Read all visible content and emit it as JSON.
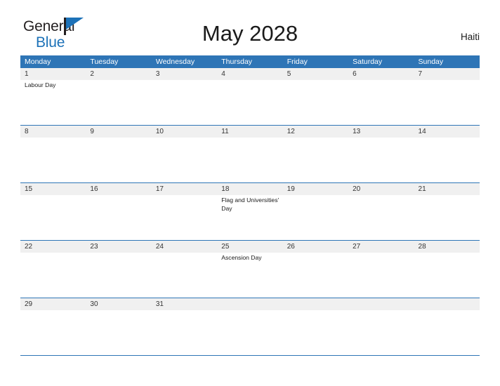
{
  "brand": {
    "line1": "General",
    "line2": "Blue",
    "flag_icon": "flag-triangle-icon",
    "color_text": "#231f20",
    "color_accent": "#1d72b8"
  },
  "header": {
    "title": "May 2028",
    "country": "Haiti"
  },
  "calendar": {
    "header_color": "#2e75b6",
    "date_band_color": "#f0f0f0",
    "weekdays": [
      "Monday",
      "Tuesday",
      "Wednesday",
      "Thursday",
      "Friday",
      "Saturday",
      "Sunday"
    ],
    "weeks": [
      {
        "days": [
          {
            "num": "1",
            "events": [
              "Labour Day"
            ]
          },
          {
            "num": "2",
            "events": []
          },
          {
            "num": "3",
            "events": []
          },
          {
            "num": "4",
            "events": []
          },
          {
            "num": "5",
            "events": []
          },
          {
            "num": "6",
            "events": []
          },
          {
            "num": "7",
            "events": []
          }
        ]
      },
      {
        "days": [
          {
            "num": "8",
            "events": []
          },
          {
            "num": "9",
            "events": []
          },
          {
            "num": "10",
            "events": []
          },
          {
            "num": "11",
            "events": []
          },
          {
            "num": "12",
            "events": []
          },
          {
            "num": "13",
            "events": []
          },
          {
            "num": "14",
            "events": []
          }
        ]
      },
      {
        "days": [
          {
            "num": "15",
            "events": []
          },
          {
            "num": "16",
            "events": []
          },
          {
            "num": "17",
            "events": []
          },
          {
            "num": "18",
            "events": [
              "Flag and Universities' Day"
            ]
          },
          {
            "num": "19",
            "events": []
          },
          {
            "num": "20",
            "events": []
          },
          {
            "num": "21",
            "events": []
          }
        ]
      },
      {
        "days": [
          {
            "num": "22",
            "events": []
          },
          {
            "num": "23",
            "events": []
          },
          {
            "num": "24",
            "events": []
          },
          {
            "num": "25",
            "events": [
              "Ascension Day"
            ]
          },
          {
            "num": "26",
            "events": []
          },
          {
            "num": "27",
            "events": []
          },
          {
            "num": "28",
            "events": []
          }
        ]
      },
      {
        "days": [
          {
            "num": "29",
            "events": []
          },
          {
            "num": "30",
            "events": []
          },
          {
            "num": "31",
            "events": []
          },
          {
            "num": "",
            "events": []
          },
          {
            "num": "",
            "events": []
          },
          {
            "num": "",
            "events": []
          },
          {
            "num": "",
            "events": []
          }
        ]
      }
    ]
  }
}
